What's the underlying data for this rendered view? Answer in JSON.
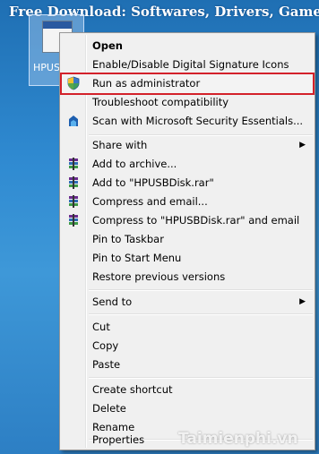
{
  "desktop": {
    "banner_text": "Free Download: Softwares, Drivers, Games,",
    "icon_label": "HPUSB",
    "watermark_text": "Taimienphi.vn",
    "background_color": "#2f8ad1"
  },
  "context_menu": {
    "items": [
      {
        "label": "Open"
      },
      {
        "label": "Enable/Disable Digital Signature Icons"
      },
      {
        "label": "Run as administrator",
        "icon": "uac-shield-icon",
        "highlighted": true
      },
      {
        "label": "Troubleshoot compatibility"
      },
      {
        "label": "Scan with Microsoft Security Essentials...",
        "icon": "security-essentials-icon"
      },
      {
        "label": "Share with",
        "submenu": true
      },
      {
        "label": "Add to archive...",
        "icon": "winrar-icon"
      },
      {
        "label": "Add to \"HPUSBDisk.rar\"",
        "icon": "winrar-icon"
      },
      {
        "label": "Compress and email...",
        "icon": "winrar-icon"
      },
      {
        "label": "Compress to \"HPUSBDisk.rar\" and email",
        "icon": "winrar-icon"
      },
      {
        "label": "Pin to Taskbar"
      },
      {
        "label": "Pin to Start Menu"
      },
      {
        "label": "Restore previous versions"
      },
      {
        "label": "Send to",
        "submenu": true
      },
      {
        "label": "Cut"
      },
      {
        "label": "Copy"
      },
      {
        "label": "Paste"
      },
      {
        "label": "Create shortcut"
      },
      {
        "label": "Delete"
      },
      {
        "label": "Rename"
      },
      {
        "label": "Properties"
      }
    ],
    "highlight_color": "#d3212a"
  }
}
